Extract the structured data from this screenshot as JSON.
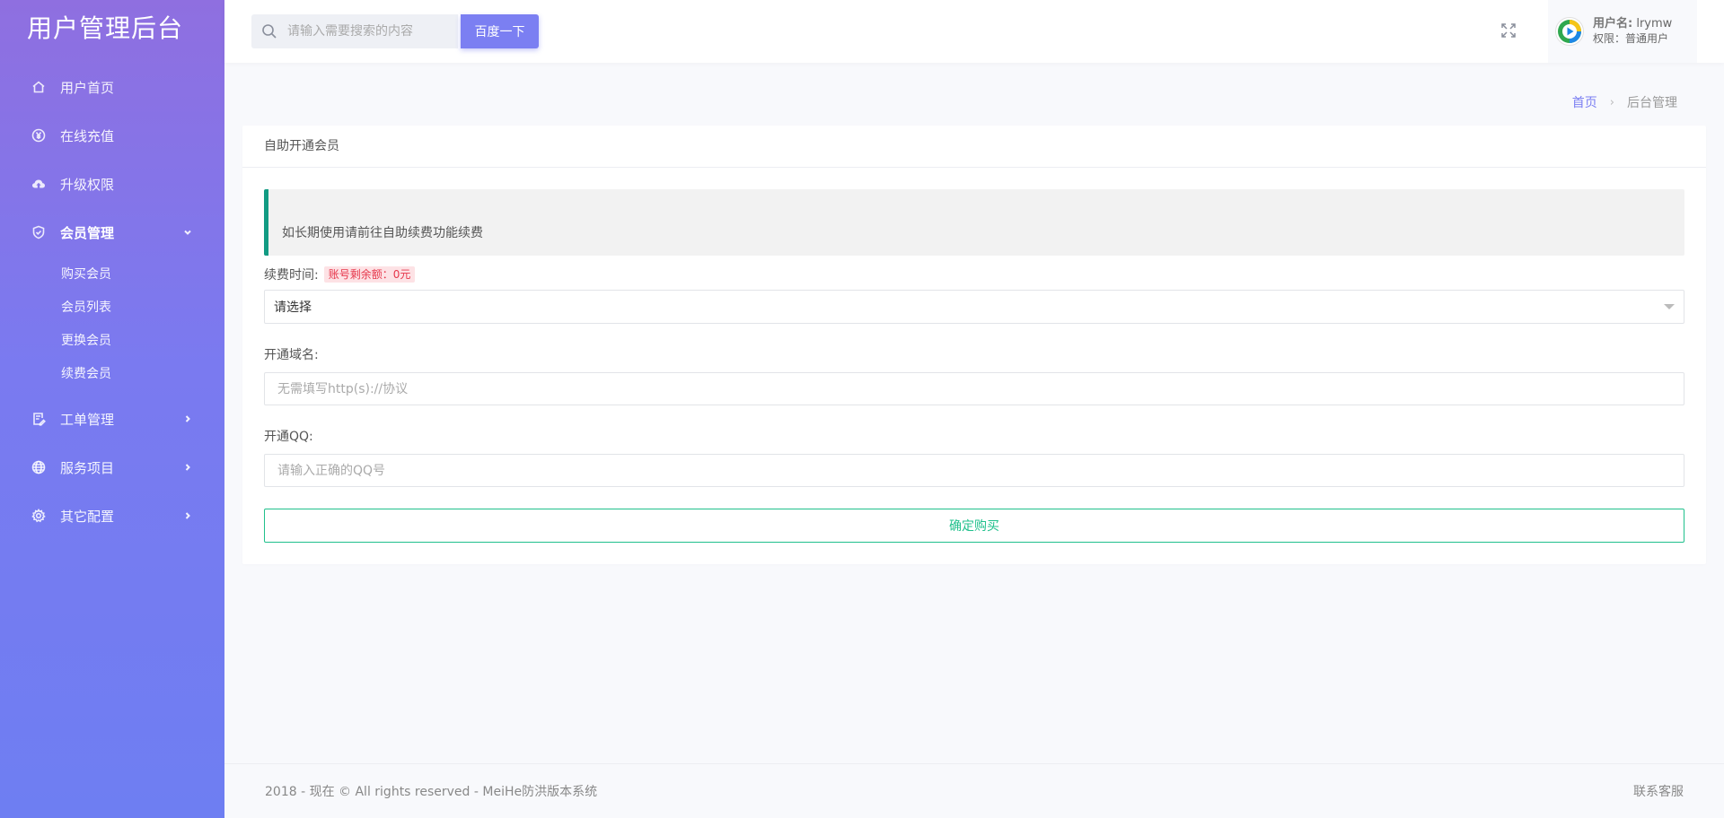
{
  "brand": {
    "title": "用户管理后台"
  },
  "sidebar": {
    "items": [
      {
        "label": "用户首页",
        "icon": "home-icon"
      },
      {
        "label": "在线充值",
        "icon": "yen-icon"
      },
      {
        "label": "升级权限",
        "icon": "cloud-upload-icon"
      },
      {
        "label": "会员管理",
        "icon": "shield-check-icon",
        "expanded": true,
        "children": [
          "购买会员",
          "会员列表",
          "更换会员",
          "续费会员"
        ]
      },
      {
        "label": "工单管理",
        "icon": "ticket-edit-icon"
      },
      {
        "label": "服务项目",
        "icon": "globe-icon"
      },
      {
        "label": "其它配置",
        "icon": "gear-icon"
      }
    ]
  },
  "header": {
    "search_placeholder": "请输入需要搜索的内容",
    "search_button": "百度一下",
    "user": {
      "name_label": "用户名:",
      "name": "lrymw",
      "role": "权限：普通用户"
    }
  },
  "breadcrumb": {
    "home": "首页",
    "sep": "›",
    "current": "后台管理"
  },
  "card": {
    "title": "自助开通会员",
    "notice": "如长期使用请前往自助续费功能续费",
    "renew_label": "续费时间:",
    "balance_badge": "账号剩余额：0元",
    "select_value": "请选择",
    "domain_label": "开通域名:",
    "domain_placeholder": "无需填写http(s)://协议",
    "qq_label": "开通QQ:",
    "qq_placeholder": "请输入正确的QQ号",
    "submit": "确定购买"
  },
  "footer": {
    "copyright": "2018 - 现在 © All rights reserved - MeiHe防洪版本系统",
    "contact": "联系客服"
  },
  "colors": {
    "accent": "#7b7ff2",
    "notice_border": "#129b83",
    "submit": "#20c08c",
    "badge_text": "#e6364a",
    "badge_bg": "#fde2e5"
  }
}
